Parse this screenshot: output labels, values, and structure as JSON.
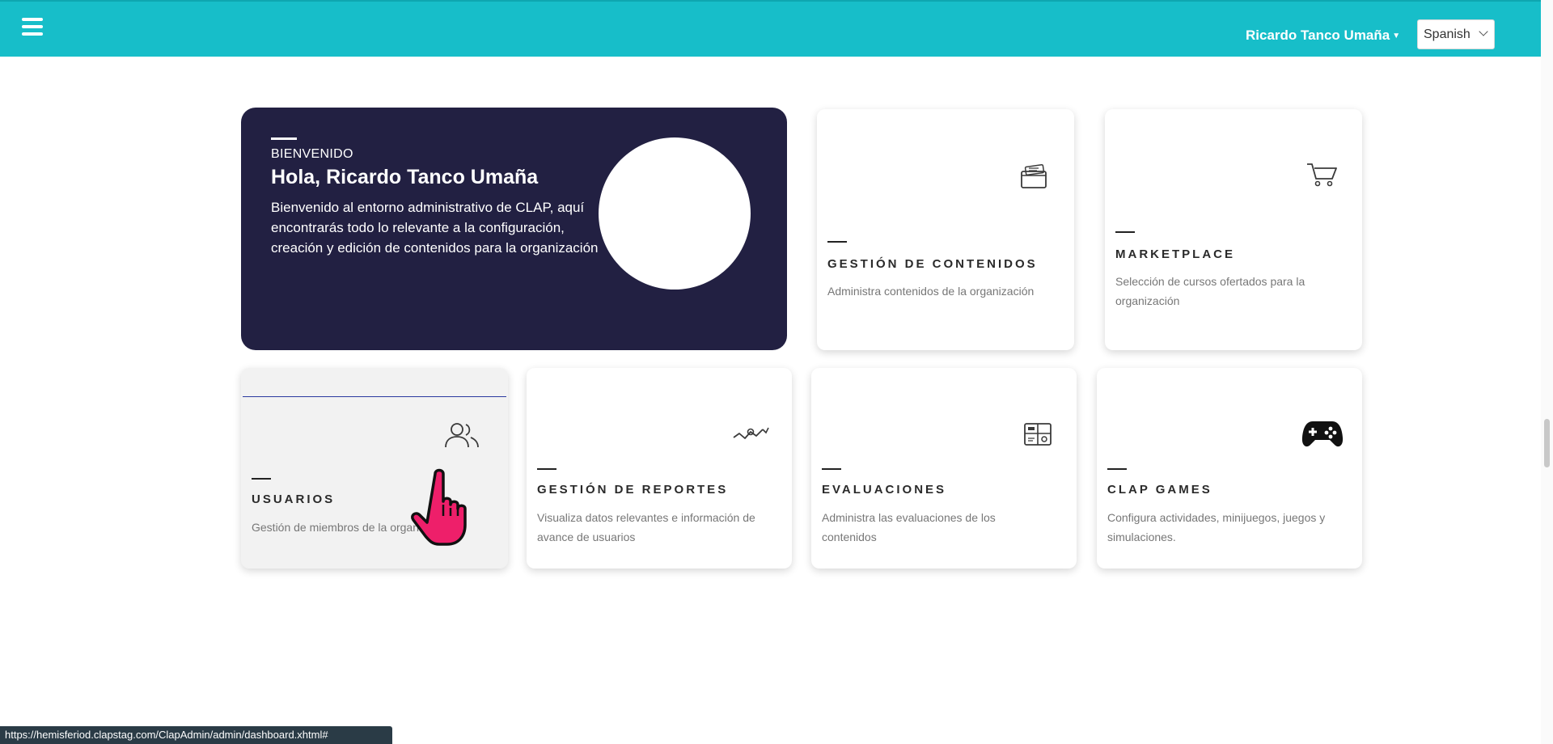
{
  "header": {
    "menu_icon": "hamburger-icon",
    "user_name": "Ricardo Tanco Umaña",
    "language": "Spanish",
    "accent_color": "#17bec9"
  },
  "welcome": {
    "eyebrow": "BIENVENIDO",
    "title": "Hola, Ricardo Tanco Umaña",
    "description": "Bienvenido al entorno administrativo de CLAP, aquí encontrarás todo lo relevante a la configuración, creación y edición de contenidos para la organización",
    "background_color": "#222042"
  },
  "modules": {
    "contenidos": {
      "title": "GESTIÓN DE CONTENIDOS",
      "description": "Administra contenidos de la organización",
      "icon": "content-folder-icon"
    },
    "marketplace": {
      "title": "MARKETPLACE",
      "description": "Selección de cursos ofertados para la organización",
      "icon": "shopping-cart-icon"
    },
    "usuarios": {
      "title": "USUARIOS",
      "description": "Gestión de miembros de la organización",
      "icon": "users-icon"
    },
    "reportes": {
      "title": "GESTIÓN DE REPORTES",
      "description": "Visualiza datos relevantes e información de avance de usuarios",
      "icon": "chart-line-icon"
    },
    "evaluaciones": {
      "title": "EVALUACIONES",
      "description": "Administra las evaluaciones de los contenidos",
      "icon": "evaluation-grid-icon"
    },
    "games": {
      "title": "CLAP GAMES",
      "description": "Configura actividades, minijuegos, juegos y simulaciones.",
      "icon": "gamepad-icon"
    }
  },
  "status_bar": {
    "url": "https://hemisferiod.clapstag.com/ClapAdmin/admin/dashboard.xhtml#"
  }
}
